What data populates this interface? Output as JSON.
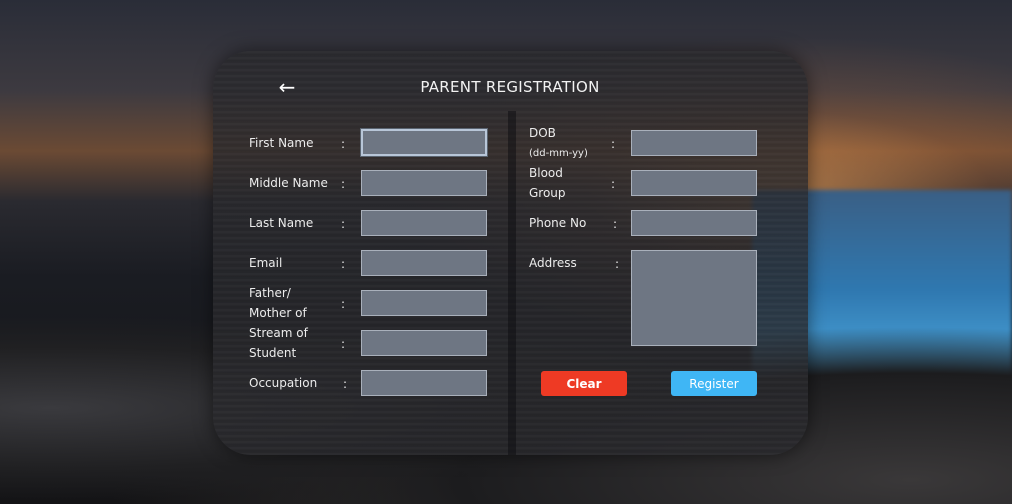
{
  "header": {
    "title": "PARENT REGISTRATION",
    "back_icon": "←"
  },
  "left_fields": [
    {
      "label": "First Name",
      "colon": ":",
      "value": ""
    },
    {
      "label": "Middle Name",
      "colon": ":",
      "value": ""
    },
    {
      "label": "Last Name",
      "colon": ":",
      "value": ""
    },
    {
      "label": "Email",
      "colon": ":",
      "value": ""
    },
    {
      "label_line1": "Father/",
      "label_line2": "Mother of",
      "colon": ":",
      "value": ""
    },
    {
      "label_line1": "Stream of",
      "label_line2": "Student",
      "colon": ":",
      "value": ""
    },
    {
      "label": "Occupation",
      "colon": ":",
      "value": ""
    }
  ],
  "right_fields": [
    {
      "label_line1": "DOB",
      "label_line2": "(dd-mm-yy)",
      "colon": ":",
      "value": ""
    },
    {
      "label_line1": "Blood",
      "label_line2": "Group",
      "colon": ":",
      "value": ""
    },
    {
      "label": "Phone No",
      "colon": ":",
      "value": ""
    },
    {
      "label": "Address",
      "colon": ":",
      "value": ""
    }
  ],
  "buttons": {
    "clear": "Clear",
    "register": "Register"
  },
  "colors": {
    "clear": "#ee3a24",
    "register": "#3fb6f5",
    "field_bg": "#6e7683"
  }
}
